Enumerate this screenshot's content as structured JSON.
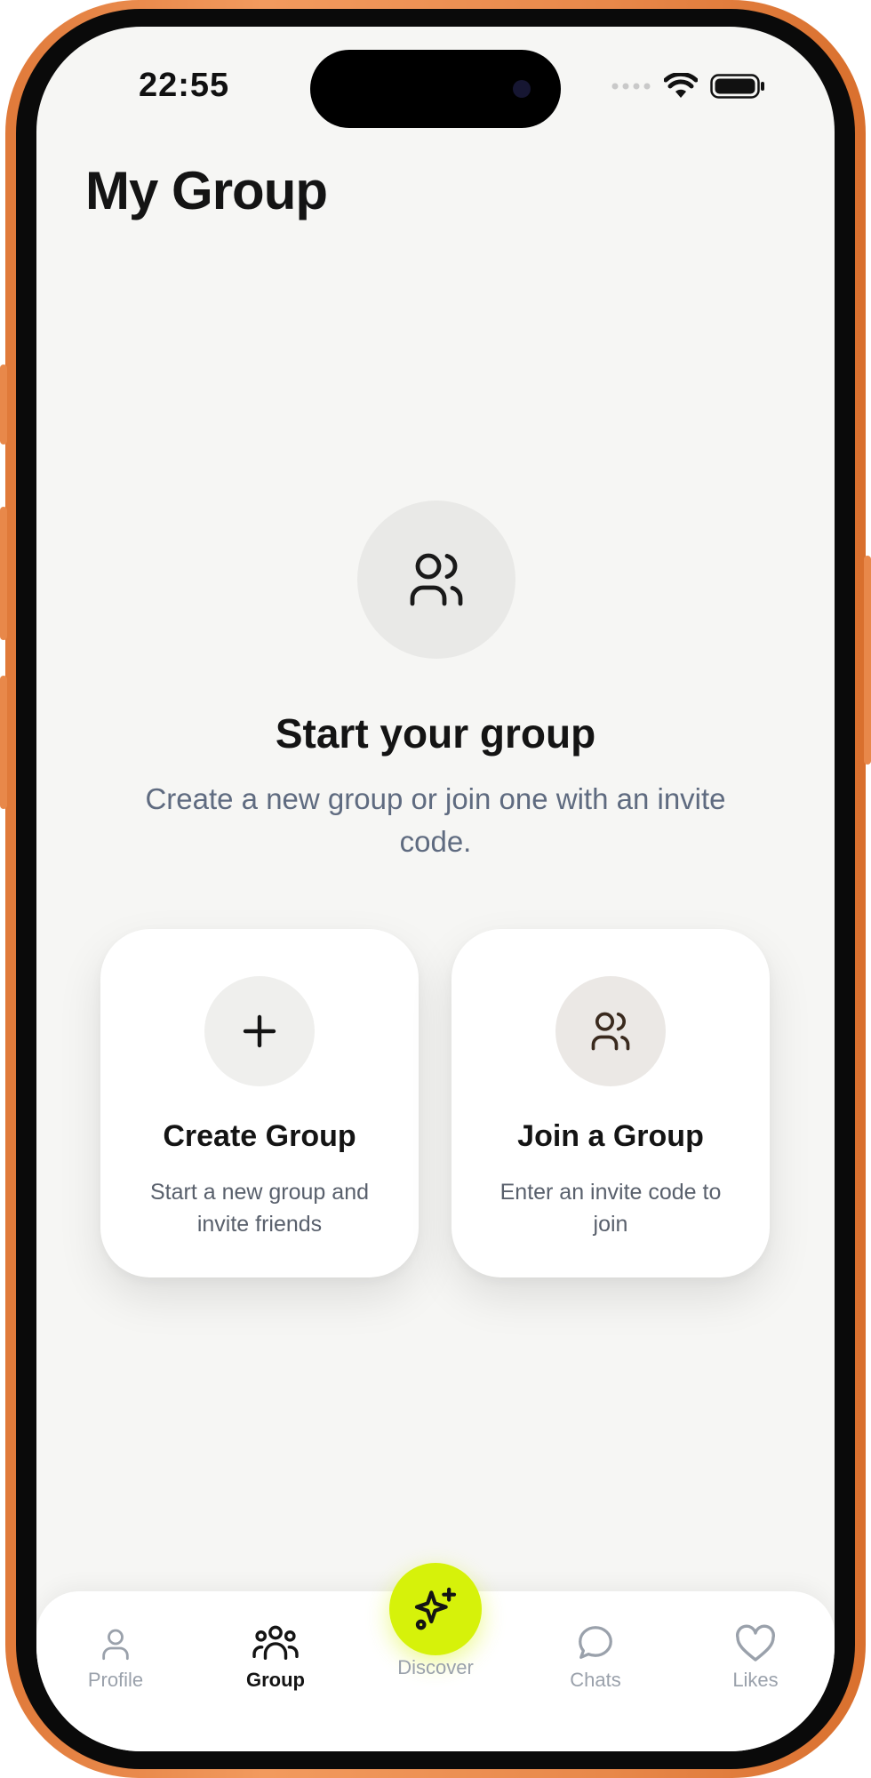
{
  "status_bar": {
    "time": "22:55"
  },
  "header": {
    "title": "My Group"
  },
  "hero": {
    "icon": "users-icon",
    "title": "Start your group",
    "subtitle": "Create a new group or join one with an invite code."
  },
  "cards": {
    "create": {
      "icon": "plus-icon",
      "title": "Create Group",
      "description": "Start a new group and invite friends"
    },
    "join": {
      "icon": "users-icon",
      "title": "Join a Group",
      "description": "Enter an invite code to join"
    }
  },
  "tabbar": {
    "active": "Group",
    "tabs": [
      {
        "label": "Profile",
        "icon": "person-icon"
      },
      {
        "label": "Group",
        "icon": "group-icon"
      },
      {
        "label": "Discover",
        "icon": "sparkle-icon"
      },
      {
        "label": "Chats",
        "icon": "chat-bubble-icon"
      },
      {
        "label": "Likes",
        "icon": "heart-icon"
      }
    ]
  },
  "colors": {
    "accent": "#d6f20a",
    "frame": "#e8884a",
    "background": "#f6f6f4",
    "subtitle_text": "#5f6b80"
  }
}
